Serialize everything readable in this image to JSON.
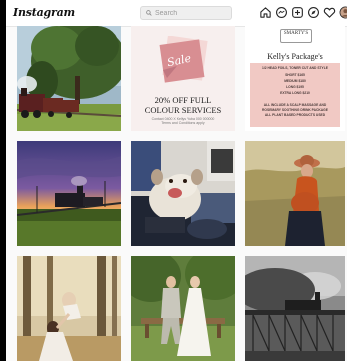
{
  "app": {
    "logo_text": "Instagram"
  },
  "search": {
    "placeholder": "Search"
  },
  "nav_icons": [
    "home-icon",
    "messenger-icon",
    "new-post-icon",
    "explore-icon",
    "activity-heart-icon",
    "profile-avatar-icon"
  ],
  "posts": [
    {
      "name": "steam-train-trees-photo"
    },
    {
      "name": "colour-services-sale-post",
      "sale_word": "Sale",
      "headline_1": "20% OFF FULL",
      "headline_2": "COLOUR SERVICES",
      "fine_1": "Contact 0400 X Kellys Yuba 000 000000",
      "fine_2": "Terms and Conditions apply"
    },
    {
      "name": "kellys-package-post",
      "brand": "SMARTY'S",
      "title": "Kelly's Package's",
      "lines": [
        "1/2 HEAD FOILS, TONER CUT AND STYLE",
        "SHORT $165",
        "MEDIUM $180",
        "LONG $195",
        "EXTRA LONG $210",
        "",
        "ALL INCLUDE A SCALP MASSAGE AND",
        "ROSEMARY SOOTHING DRINK PACKAGE",
        "ALL PLANT BASED PRODUCTS USED"
      ]
    },
    {
      "name": "sunset-locomotive-photo"
    },
    {
      "name": "dog-on-couch-photo"
    },
    {
      "name": "pregnant-woman-field-photo"
    },
    {
      "name": "mother-child-forest-photo"
    },
    {
      "name": "wedding-couple-bench-photo"
    },
    {
      "name": "black-white-train-bridge-photo"
    }
  ]
}
